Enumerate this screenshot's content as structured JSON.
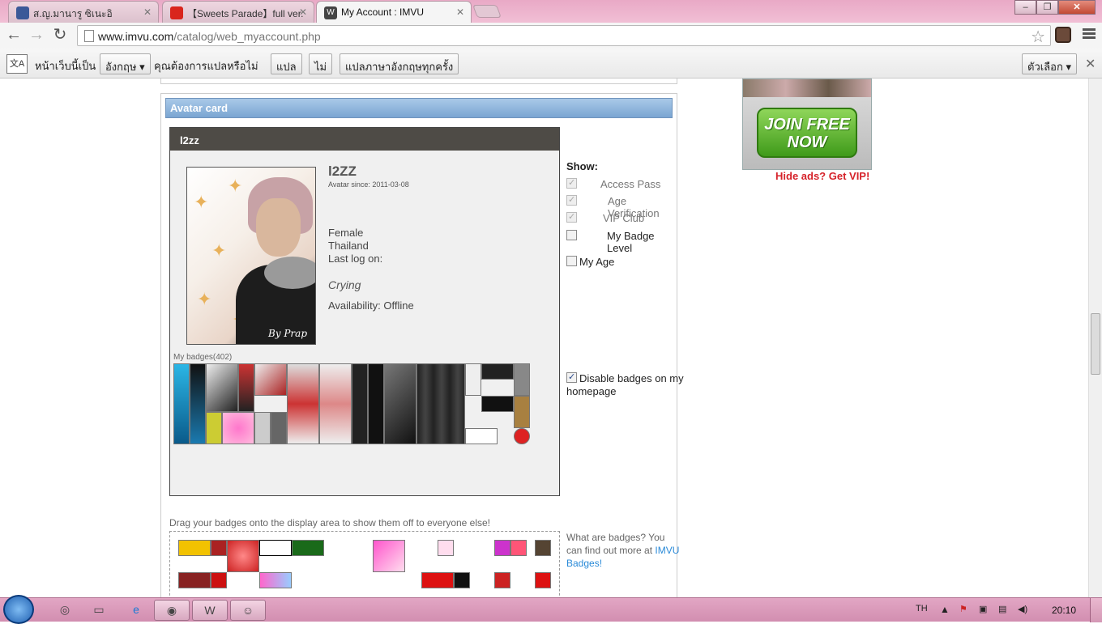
{
  "browser": {
    "tabs": [
      {
        "label": "ส.ญ.มานารู ซิเนะอิ",
        "icon": "facebook-icon"
      },
      {
        "label": "【Sweets Parade】full ver.",
        "icon": "youtube-icon"
      },
      {
        "label": "My Account : IMVU",
        "icon": "imvu-icon",
        "active": true
      }
    ],
    "url_host": "www.imvu.com",
    "url_path": "/catalog/web_myaccount.php"
  },
  "translate_bar": {
    "prompt": "หน้าเว็บนี้เป็น",
    "language": "อังกฤษ ▾",
    "question": "คุณต้องการแปลหรือไม่",
    "translate_btn": "แปล",
    "no_btn": "ไม่",
    "always_btn": "แปลภาษาอังกฤษทุกครั้ง",
    "options_btn": "ตัวเลือก ▾"
  },
  "avatar_card": {
    "section_title": "Avatar card",
    "card_header": "l2zz",
    "name": "l2ZZ",
    "since": "Avatar since: 2011-03-08",
    "gender": "Female",
    "country": "Thailand",
    "last_log": "Last log on:",
    "mood": "Crying",
    "availability": "Availability: Offline",
    "badges_label": "My badges(402)",
    "avatar_signature": "By Prap"
  },
  "show_options": {
    "title": "Show:",
    "items": [
      {
        "label": "Access Pass",
        "checked": true,
        "disabled": true
      },
      {
        "label": "Age Verification",
        "checked": true,
        "disabled": true
      },
      {
        "label": "VIP Club",
        "checked": true,
        "disabled": true
      },
      {
        "label": "My Badge Level",
        "checked": false,
        "disabled": false
      }
    ],
    "my_age": "My Age",
    "disable_badges": "Disable badges on my homepage"
  },
  "drag": {
    "text": "Drag your badges onto the display area to show them off to everyone else!",
    "what_text": "What are badges? You can find out more at",
    "what_link": "IMVU Badges!"
  },
  "ad": {
    "join": "JOIN FREE NOW",
    "hide": "Hide ads? Get VIP!"
  },
  "taskbar": {
    "lang": "TH",
    "time": "20:10"
  },
  "colors": {
    "card_head": "#7aa5d2",
    "link": "#2a8ad8",
    "hide_ads": "#d6222a"
  }
}
